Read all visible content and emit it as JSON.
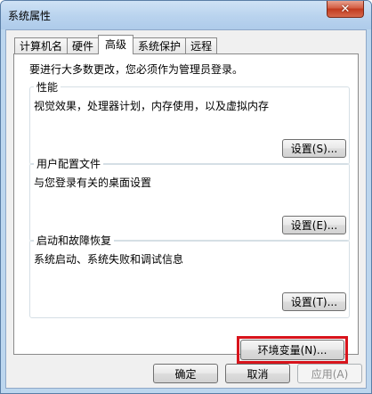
{
  "window": {
    "title": "系统属性",
    "close_glyph": "✕"
  },
  "tabs": [
    {
      "label": "计算机名"
    },
    {
      "label": "硬件"
    },
    {
      "label": "高级",
      "active": true
    },
    {
      "label": "系统保护"
    },
    {
      "label": "远程"
    }
  ],
  "admin_note": "要进行大多数更改，您必须作为管理员登录。",
  "groups": {
    "performance": {
      "label": "性能",
      "desc": "视觉效果，处理器计划，内存使用，以及虚拟内存",
      "button": "设置(S)..."
    },
    "profiles": {
      "label": "用户配置文件",
      "desc": "与您登录有关的桌面设置",
      "button": "设置(E)..."
    },
    "startup": {
      "label": "启动和故障恢复",
      "desc": "系统启动、系统失败和调试信息",
      "button": "设置(T)..."
    }
  },
  "env_button": "环境变量(N)...",
  "footer": {
    "ok": "确定",
    "cancel": "取消",
    "apply": "应用(A)"
  },
  "colors": {
    "highlight": "#d8141c",
    "titlebar": "#b9d3ee",
    "close": "#c13a1f"
  }
}
